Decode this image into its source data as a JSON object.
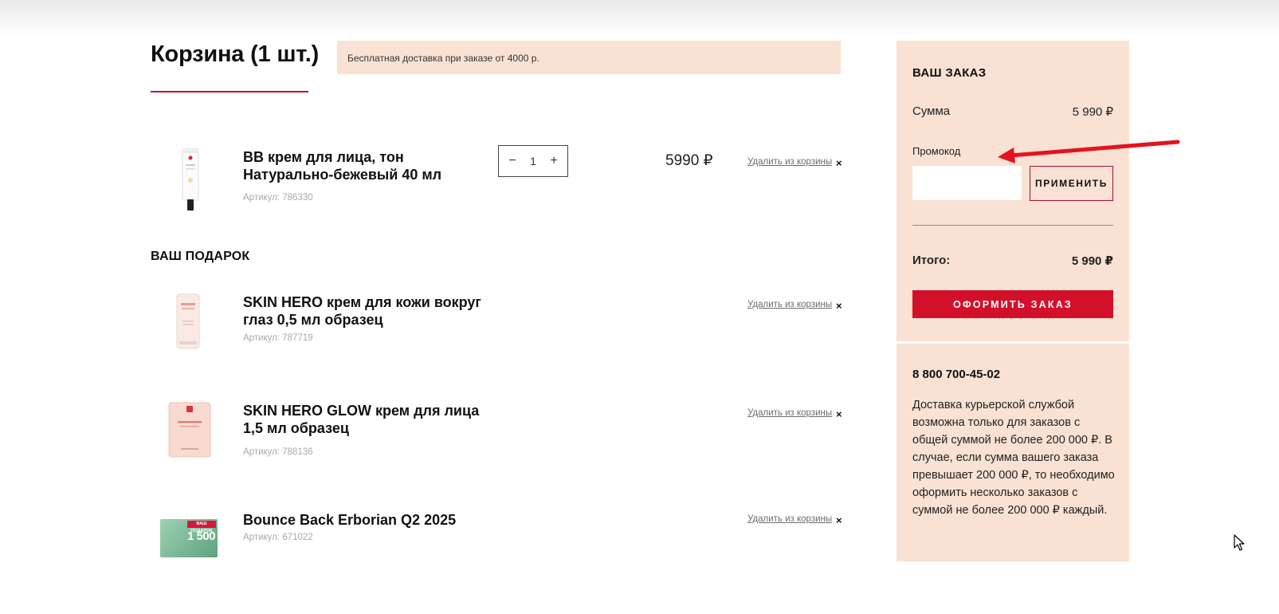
{
  "cart": {
    "title": "Корзина (1 шт.)",
    "shipping_banner": "Бесплатная доставка при заказе от 4000 р.",
    "main_item": {
      "name": "BB крем для лица, тон Натурально-бежевый 40 мл",
      "sku": "Артикул: 786330",
      "quantity": "1",
      "qty_minus": "−",
      "qty_plus": "+",
      "price": "5990 ₽",
      "remove_label": "Удалить из корзины",
      "remove_icon": "×"
    },
    "gift_title": "ВАШ ПОДАРОК",
    "gifts": [
      {
        "name": "SKIN HERO крем для кожи вокруг глаз 0,5 мл образец",
        "sku": "Артикул: 787719",
        "remove_label": "Удалить из корзины",
        "remove_icon": "×"
      },
      {
        "name": "SKIN HERO GLOW крем для лица 1,5 мл образец",
        "sku": "Артикул: 788136",
        "remove_label": "Удалить из корзины",
        "remove_icon": "×"
      },
      {
        "name": "Bounce Back Erborian Q2 2025",
        "sku": "Артикул: 671022",
        "remove_label": "Удалить из корзины",
        "remove_icon": "×",
        "thumb_badge": "ВАШ ПОДАРОК",
        "thumb_value": "1 500"
      }
    ]
  },
  "summary": {
    "title": "ВАШ ЗАКАЗ",
    "sum_label": "Сумма",
    "sum_value": "5 990 ₽",
    "promo_label": "Промокод",
    "promo_placeholder": "",
    "apply_label": "ПРИМЕНИТЬ",
    "total_label": "Итого:",
    "total_value": "5 990 ₽",
    "checkout_label": "ОФОРМИТЬ ЗАКАЗ"
  },
  "info": {
    "phone": "8 800 700-45-02",
    "delivery_text": "Доставка курьерской службой возможна только для заказов с общей суммой не более 200 000 ₽. В случае, если сумма вашего заказа превышает 200 000 ₽, то необходимо оформить несколько заказов с суммой не более 200 000 ₽ каждый."
  },
  "colors": {
    "accent": "#d2102a",
    "panel": "#f9e1d3",
    "annotation_arrow": "#e5121f"
  },
  "icons": {
    "annotation": "red-arrow-icon",
    "cursor": "mouse-pointer-icon"
  }
}
